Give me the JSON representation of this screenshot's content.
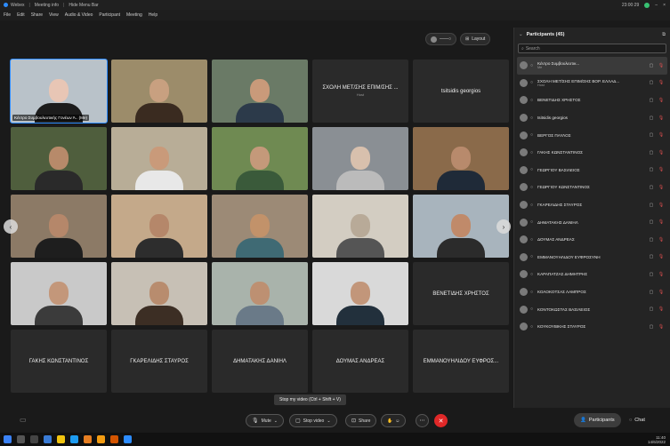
{
  "titlebar": {
    "app": "Webex",
    "tab": "Meeting info",
    "tab2": "Hide Menu Bar",
    "time": "23:00:29"
  },
  "menu": [
    "File",
    "Edit",
    "Share",
    "View",
    "Audio & Video",
    "Participant",
    "Meeting",
    "Help"
  ],
  "view_controls": {
    "layout_label": "Layout"
  },
  "tiles": [
    {
      "name": "Κέντρο Συμβουλευτικής Γονέων Ά.. (Me)",
      "type": "video",
      "skin": "#e8c6b5",
      "shirt": "#1c1c1c",
      "bg": "#b9c2c9",
      "active": true
    },
    {
      "name": "",
      "type": "video",
      "skin": "#c8a080",
      "shirt": "#3a2b20",
      "bg": "#9c8c6a"
    },
    {
      "name": "",
      "type": "video",
      "skin": "#c99a7a",
      "shirt": "#2c3a4a",
      "bg": "#6a7a66"
    },
    {
      "name": "ΣΧΟΛΗ ΜΕΤ/ΣΗΣ ΕΠΙΜ/ΣΗΣ ...",
      "sub": "Host",
      "type": "text"
    },
    {
      "name": "tsitsidis georgios",
      "type": "text"
    },
    {
      "name": "",
      "type": "video",
      "skin": "#b78a6a",
      "shirt": "#2a2a2a",
      "bg": "#4f5e3d"
    },
    {
      "name": "",
      "type": "video",
      "skin": "#c99a7a",
      "shirt": "#e8e8e8",
      "bg": "#b8ad97"
    },
    {
      "name": "",
      "type": "video",
      "skin": "#c4997a",
      "shirt": "#3a5a3a",
      "bg": "#6f8a52"
    },
    {
      "name": "",
      "type": "video",
      "skin": "#d8c0ad",
      "shirt": "#bbb",
      "bg": "#8a8f94"
    },
    {
      "name": "",
      "type": "video",
      "skin": "#b88a6c",
      "shirt": "#1f2a38",
      "bg": "#8a6a4a"
    },
    {
      "name": "",
      "type": "video",
      "skin": "#b5876a",
      "shirt": "#1e1e1e",
      "bg": "#8c7a66"
    },
    {
      "name": "",
      "type": "video",
      "skin": "#b5876a",
      "shirt": "#2d2d2d",
      "bg": "#c4a98a"
    },
    {
      "name": "",
      "type": "video",
      "skin": "#c2926a",
      "shirt": "#3f6a74",
      "bg": "#9c8a76"
    },
    {
      "name": "",
      "type": "video",
      "skin": "#b8aa98",
      "shirt": "#555",
      "bg": "#d3cdc2"
    },
    {
      "name": "",
      "type": "video",
      "skin": "#c08a6a",
      "shirt": "#2b2b2b",
      "bg": "#a8b4bd"
    },
    {
      "name": "",
      "type": "video",
      "skin": "#c3977a",
      "shirt": "#3b3b3b",
      "bg": "#c9c9c9"
    },
    {
      "name": "",
      "type": "video",
      "skin": "#b88c6e",
      "shirt": "#3c2e24",
      "bg": "#c7c0b5"
    },
    {
      "name": "",
      "type": "video",
      "skin": "#bd9072",
      "shirt": "#6a7a88",
      "bg": "#a9b3ab"
    },
    {
      "name": "",
      "type": "video",
      "skin": "#c2967a",
      "shirt": "#22303c",
      "bg": "#d9d9d9"
    },
    {
      "name": "ΒΕΝΕΤΙΔΗΣ ΧΡΗΣΤΟΣ",
      "type": "text"
    },
    {
      "name": "ΓΑΚΗΣ ΚΩΝΣΤΑΝΤΙΝΟΣ",
      "type": "text"
    },
    {
      "name": "ΓΚΑΡΕΛΙΔΗΣ ΣΤΑΥΡΟΣ",
      "type": "text"
    },
    {
      "name": "ΔΗΜΑΤΑΚΗΣ ΔΑΝΙΗΛ",
      "type": "text"
    },
    {
      "name": "ΔΟΥΜΑΣ ΑΝΔΡΕΑΣ",
      "type": "text"
    },
    {
      "name": "ΕΜΜΑΝΟΥΗΛΙΔΟΥ ΕΥΦΡΟΣ...",
      "type": "text"
    }
  ],
  "tooltip": "Stop my video (Ctrl + Shift + V)",
  "toolbar": {
    "mute": "Mute",
    "stop_video": "Stop video",
    "share": "Share",
    "participants": "Participants",
    "chat": "Chat"
  },
  "panel": {
    "title": "Participants (45)",
    "search_placeholder": "Search",
    "participants": [
      {
        "name": "Κέντρο Συμβουλευτικ...",
        "role": "Me"
      },
      {
        "name": "ΣΧΟΛΗ ΜΕΤ/ΣΗΣ ΕΠΙΜ/ΣΗΣ ΒΟΡ. ΕΛΛΑΔ...",
        "role": "Host"
      },
      {
        "name": "ΒΕΝΕΤΙΔΗΣ ΧΡΗΣΤΟΣ",
        "role": ""
      },
      {
        "name": "tsitsidis georgios",
        "role": ""
      },
      {
        "name": "ΒΕΡΓΟΣ ΠΑΥΛΟΣ",
        "role": ""
      },
      {
        "name": "ΓΑΚΗΣ ΚΩΝΣΤΑΝΤΙΝΟΣ",
        "role": ""
      },
      {
        "name": "ΓΕΩΡΓΙΟΥ ΒΑΣΙΛΕΙΟΣ",
        "role": ""
      },
      {
        "name": "ΓΕΩΡΓΙΟΥ ΚΩΝΣΤΑΝΤΙΝΟΣ",
        "role": ""
      },
      {
        "name": "ΓΚΑΡΕΛΙΔΗΣ ΣΤΑΥΡΟΣ",
        "role": ""
      },
      {
        "name": "ΔΗΜΑΤΑΚΗΣ ΔΑΝΙΗΛ",
        "role": ""
      },
      {
        "name": "ΔΟΥΜΑΣ ΑΝΔΡΕΑΣ",
        "role": ""
      },
      {
        "name": "ΕΜΜΑΝΟΥΗΛΙΔΟΥ ΕΥΦΡΟΣΥΝΗ",
        "role": ""
      },
      {
        "name": "ΚΑΡΑΠΑΤΖΑΣ ΔΗΜΗΤΡΗΣ",
        "role": ""
      },
      {
        "name": "ΚΟΛΟΚΟΤΣΑΣ ΛΑΜΠΡΟΣ",
        "role": ""
      },
      {
        "name": "ΚΟΝΤΟΚΩΣΤΑΣ ΒΑΣΙΛΕΙΟΣ",
        "role": ""
      },
      {
        "name": "ΚΟΥΚΟΥΒΙΚΗΣ ΣΤΑΥΡΟΣ",
        "role": ""
      }
    ]
  },
  "taskbar": {
    "time": "11:40",
    "date": "14/6/2022"
  },
  "colors": {
    "accent": "#2d8cff",
    "end": "#e02828"
  }
}
